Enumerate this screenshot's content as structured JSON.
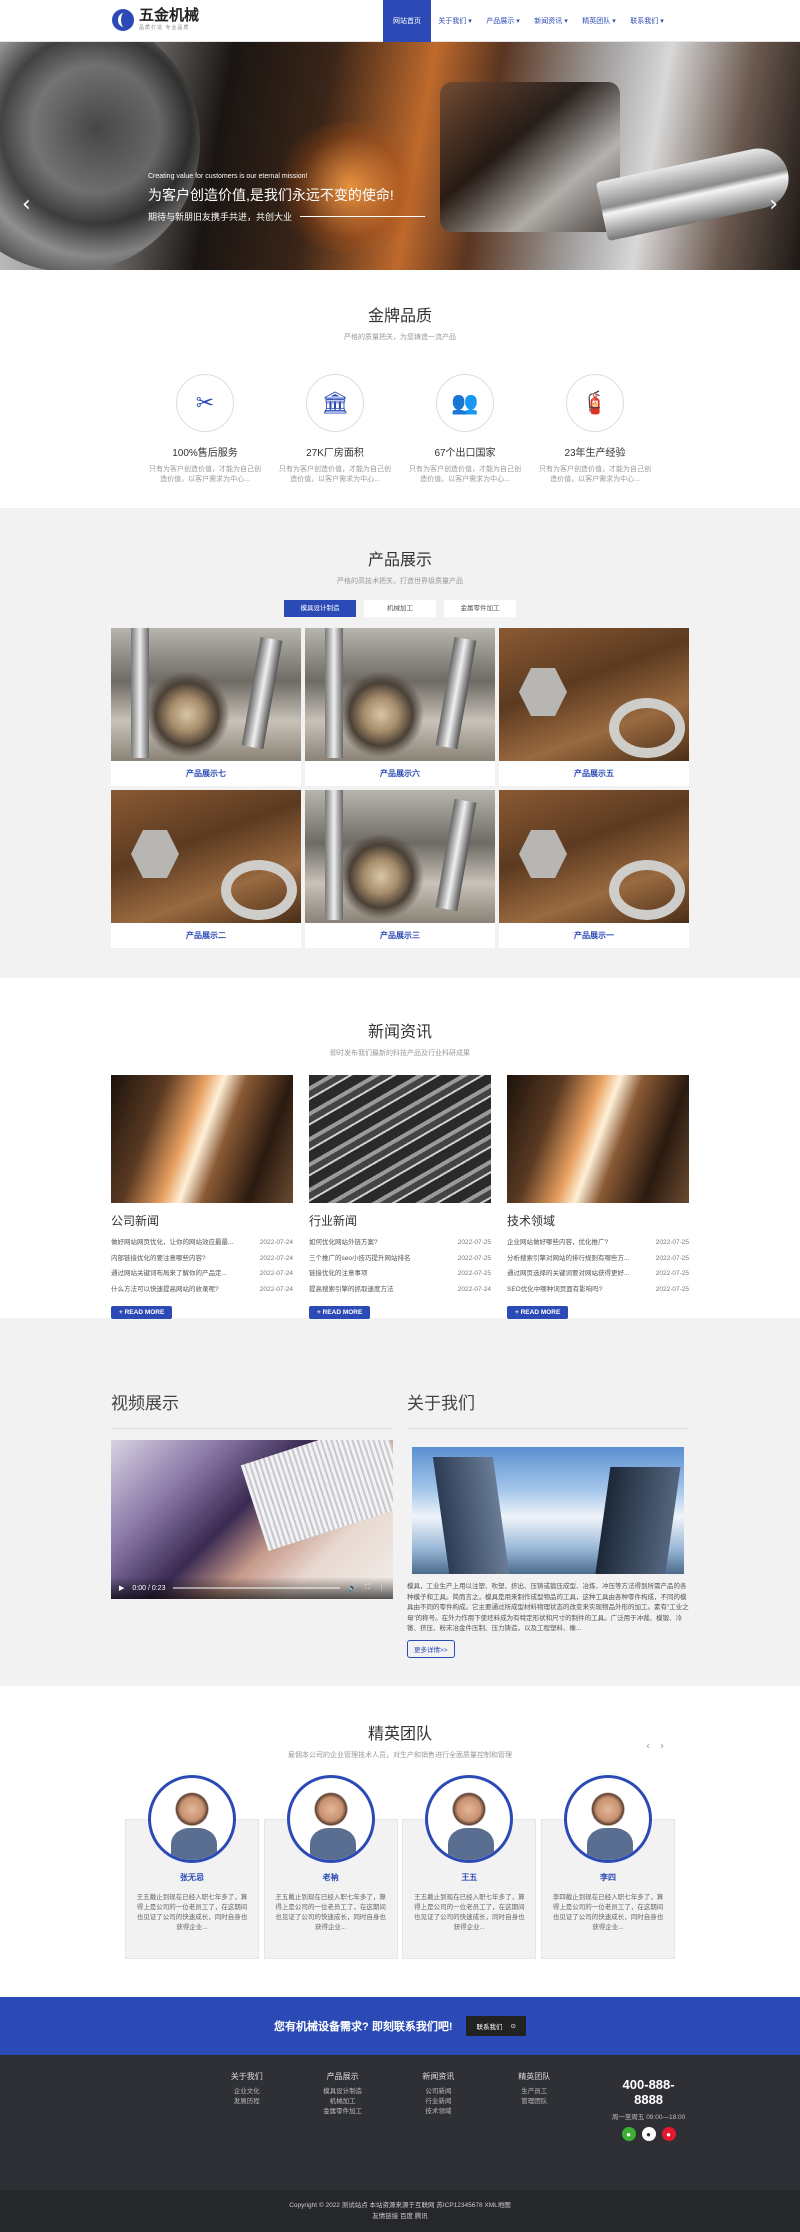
{
  "header": {
    "logo_title": "五金机械",
    "logo_sub": "品质打造 专业品质",
    "nav": [
      "网站首页",
      "关于我们 ▾",
      "产品展示 ▾",
      "新闻资讯 ▾",
      "精英团队 ▾",
      "联系我们 ▾"
    ]
  },
  "banner": {
    "en": "Creating value for customers is our eternal mission!",
    "cn": "为客户创造价值,是我们永远不变的使命!",
    "sub": "期待与新朋旧友携手共进，共创大业",
    "prev": "‹",
    "next": "›"
  },
  "quality": {
    "title": "金牌品质",
    "subtitle": "严格的质量把关，为您铸造一流产品",
    "items": [
      {
        "icon": "✂",
        "title": "100%售后服务",
        "desc1": "只有为客户创造价值，才能为自己创",
        "desc2": "造价值，以客户需求为中心..."
      },
      {
        "icon": "🏛",
        "title": "27K厂房面积",
        "desc1": "只有为客户创造价值，才能为自己创",
        "desc2": "造价值，以客户需求为中心..."
      },
      {
        "icon": "👥",
        "title": "67个出口国家",
        "desc1": "只有为客户创造价值，才能为自己创",
        "desc2": "造价值，以客户需求为中心..."
      },
      {
        "icon": "🧯",
        "title": "23年生产经验",
        "desc1": "只有为客户创造价值，才能为自己创",
        "desc2": "造价值，以客户需求为中心..."
      }
    ]
  },
  "products": {
    "title": "产品展示",
    "subtitle": "严格的高技术把关，打造世界级质量产品",
    "tabs": [
      "模具设计制造",
      "机械加工",
      "金属零件加工"
    ],
    "items": [
      "产品展示七",
      "产品展示六",
      "产品展示五",
      "产品展示二",
      "产品展示三",
      "产品展示一"
    ]
  },
  "news": {
    "title": "新闻资讯",
    "subtitle": "即时发布我们最新的科技产品及行业科研成果",
    "button": "+ READ MORE",
    "columns": [
      {
        "category": "公司新闻",
        "rows": [
          {
            "t": "做好网站网页优化，让你的网站效应最最...",
            "d": "2022-07-24"
          },
          {
            "t": "内部链接优化的要注意哪些内容?",
            "d": "2022-07-24"
          },
          {
            "t": "通过网站关键词布局来了解你的产品定...",
            "d": "2022-07-24"
          },
          {
            "t": "什么方法可以快速提高网站的收录呢?",
            "d": "2022-07-24"
          }
        ]
      },
      {
        "category": "行业新闻",
        "rows": [
          {
            "t": "如何优化网站外链方案?",
            "d": "2022-07-25"
          },
          {
            "t": "三个推广的seo小技巧提升网站排名",
            "d": "2022-07-25"
          },
          {
            "t": "链接优化的注意事项",
            "d": "2022-07-25"
          },
          {
            "t": "提高搜索引擎的抓取速度方法",
            "d": "2022-07-24"
          }
        ]
      },
      {
        "category": "技术领域",
        "rows": [
          {
            "t": "企业网站做好哪些内容，优化推广?",
            "d": "2022-07-25"
          },
          {
            "t": "分析搜索引擎对网站的排行规则有哪些方...",
            "d": "2022-07-25"
          },
          {
            "t": "通过网页选择的关键词要对网站获得更好...",
            "d": "2022-07-25"
          },
          {
            "t": "SEO优化中哪种词页面有影响吗?",
            "d": "2022-07-25"
          }
        ]
      }
    ]
  },
  "video": {
    "title": "视频展示",
    "time": "0:00 / 0:23"
  },
  "about": {
    "title": "关于我们",
    "text": "模具，工业生产上用以注塑、吹塑、挤出、压铸或锻压成型、冶炼、冲压等方法得到所需产品的各种模子和工具。简而言之，模具是用来制作成型物品的工具，这种工具由各种零件构成，不同的模具由不同的零件构成。它主要通过所成型材料物理状态的改变来实现物品外形的加工。素有“工业之母”的称号。在外力作用下使坯料成为有特定形状和尺寸的制件的工具。广泛用于冲裁、模锻、冷镦、挤压、粉末冶金件压制、压力铸造，以及工程塑料、橡...",
    "button": "更多详情>>"
  },
  "team": {
    "title": "精英团队",
    "subtitle": "雇佣本公司的企业管理技术人员，对生产和销售进行全面质量控制和管理",
    "prev": "‹",
    "next": "›",
    "members": [
      {
        "name": "张无忌",
        "desc": "王五戴止到现在已经入职七年多了，算得上是公司的一位老员工了，在这期间也见证了公司的快速成长，同时自身也获得企业..."
      },
      {
        "name": "老衲",
        "desc": "王五戴止到现在已经入职七年多了，算得上是公司的一位老员工了，在这期间也见证了公司的快速成长，同时自身也获得企业..."
      },
      {
        "name": "王五",
        "desc": "王五戴止到现在已经入职七年多了，算得上是公司的一位老员工了，在这期间也见证了公司的快速成长，同时自身也获得企业..."
      },
      {
        "name": "李四",
        "desc": "李四截止到现在已经入职七年多了，算得上是公司的一位老员工了，在这期间也见证了公司的快速成长，同时自身也获得企业..."
      }
    ]
  },
  "cta": {
    "text": "您有机械设备需求? 即刻联系我们吧!",
    "button": "联系我们",
    "icon": "⊙"
  },
  "footer": {
    "columns": [
      {
        "head": "关于我们",
        "links": [
          "企业文化",
          "发展历程"
        ]
      },
      {
        "head": "产品展示",
        "links": [
          "模具设计制造",
          "机械加工",
          "金属零件加工"
        ]
      },
      {
        "head": "新闻资讯",
        "links": [
          "公司新闻",
          "行业新闻",
          "技术领域"
        ]
      },
      {
        "head": "精英团队",
        "links": [
          "生产员工",
          "管理团队"
        ]
      }
    ],
    "phone": "400-888-8888",
    "hours": "周一至周五 09:00—18:00",
    "copyright": "Copyright © 2022 测试站点 本站资源来源于互联网 苏ICP12345678 XML地图",
    "links": "友情链接 百度 腾讯"
  }
}
